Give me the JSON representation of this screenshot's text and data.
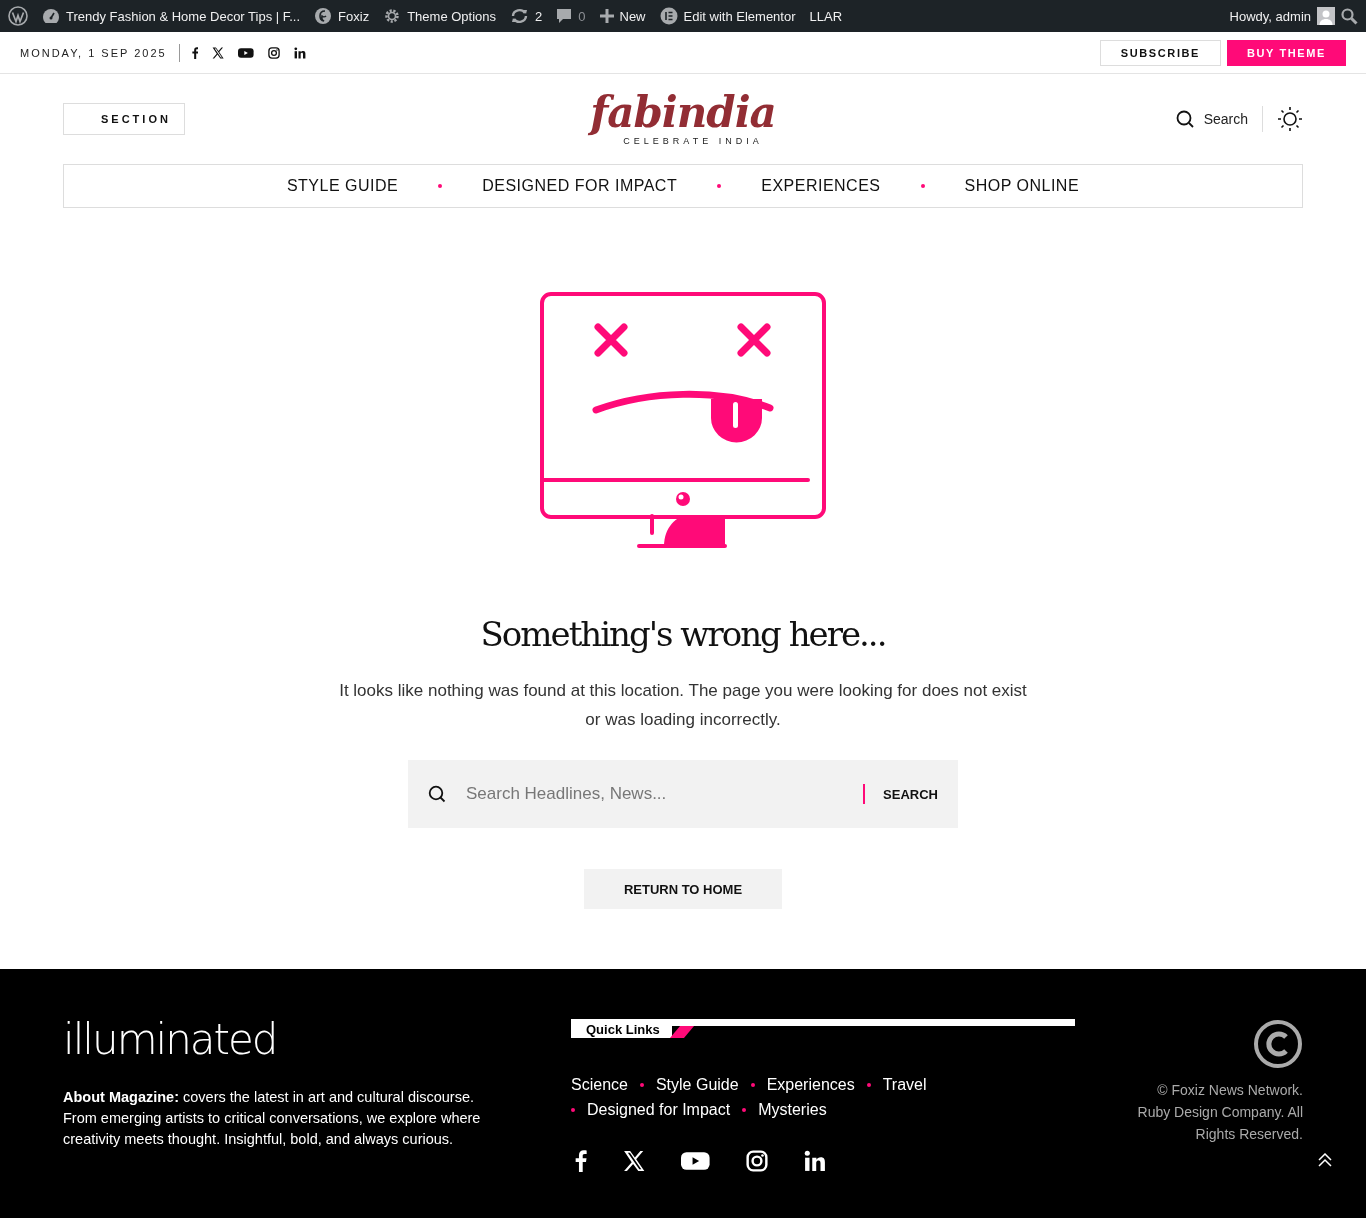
{
  "admin_bar": {
    "items": [
      {
        "kind": "dashboard",
        "label": "Trendy Fashion & Home Decor Tips | F..."
      },
      {
        "kind": "theme",
        "label": "Foxiz"
      },
      {
        "kind": "gear",
        "label": "Theme Options"
      },
      {
        "kind": "updates",
        "label": "2"
      },
      {
        "kind": "comments",
        "label": "0"
      },
      {
        "kind": "new",
        "label": "New"
      },
      {
        "kind": "elementor",
        "label": "Edit with Elementor"
      },
      {
        "kind": "plain",
        "label": "LLAR"
      }
    ],
    "greeting": "Howdy, admin"
  },
  "top_bar": {
    "date": "MONDAY, 1 SEP 2025",
    "subscribe": "SUBSCRIBE",
    "buy": "BUY THEME"
  },
  "header": {
    "section": "SECTION",
    "logo": "fabindia",
    "tagline": "CELEBRATE INDIA",
    "search": "Search"
  },
  "nav": [
    "STYLE GUIDE",
    "DESIGNED FOR IMPACT",
    "EXPERIENCES",
    "SHOP ONLINE"
  ],
  "error": {
    "heading": "Something's wrong here...",
    "message": "It looks like nothing was found at this location. The page you were looking for does not exist or was loading incorrectly.",
    "search_placeholder": "Search Headlines, News...",
    "search_button": "SEARCH",
    "return": "RETURN TO HOME"
  },
  "footer": {
    "logo": "illuminated",
    "about": "**About Magazine:** covers the latest in art and cultural discourse. From emerging artists to critical conversations, we explore where creativity meets thought. Insightful, bold, and always curious.",
    "quick_links_title": "Quick Links",
    "links": [
      "Science",
      "Style Guide",
      "Experiences",
      "Travel",
      "Designed for Impact",
      "Mysteries"
    ],
    "copyright": "© Foxiz News Network. Ruby Design Company. All Rights Reserved."
  }
}
